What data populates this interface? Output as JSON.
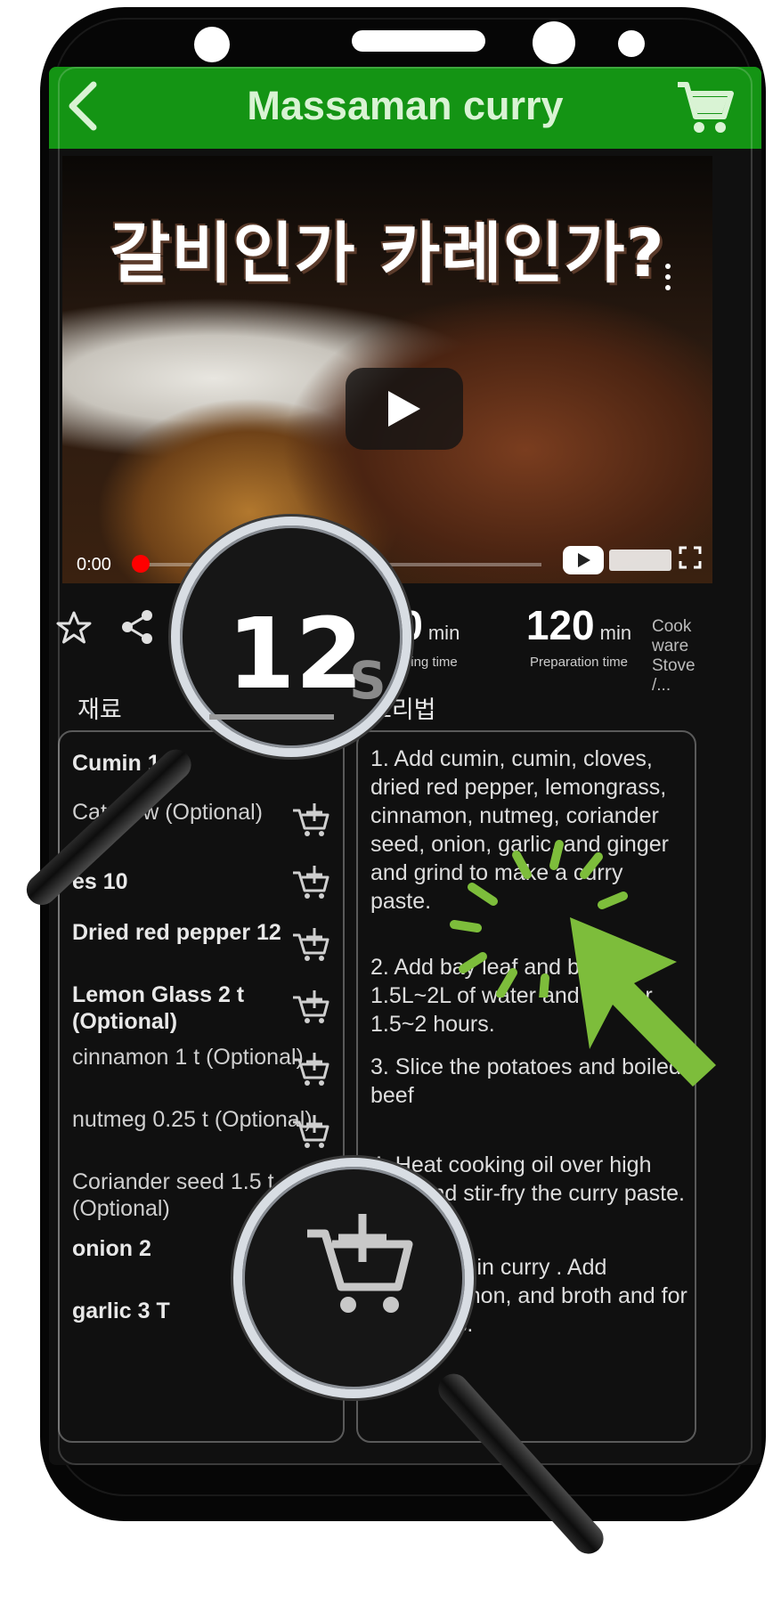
{
  "app": {
    "title": "Massaman curry"
  },
  "video": {
    "caption": "갈비인가 카레인가?",
    "current_time": "0:00",
    "progress": 0.0
  },
  "stats": {
    "cooking": {
      "value": "30",
      "unit": "min",
      "label": "Cooking time"
    },
    "preparation": {
      "value": "120",
      "unit": "min",
      "label": "Preparation time"
    },
    "cookware": "Cook ware Stove /..."
  },
  "sections": {
    "ingredients_title": "재료",
    "recipe_title": "조리법"
  },
  "ingredients": [
    {
      "name": "Cumin  1.5",
      "bold": true
    },
    {
      "name": "Catchew (Optional)",
      "bold": false
    },
    {
      "name": "es  10",
      "bold": true
    },
    {
      "name": "Dried red pepper 12",
      "bold": true
    },
    {
      "name": "Lemon Glass  2 t (Optional)",
      "bold": true
    },
    {
      "name": "cinnamon  1 t (Optional)",
      "bold": false
    },
    {
      "name": "nutmeg  0.25 t (Optional)",
      "bold": false
    },
    {
      "name": "Coriander seed  1.5 t (Optional)",
      "bold": false
    },
    {
      "name": "onion  2",
      "bold": true
    },
    {
      "name": "garlic  3 T",
      "bold": true
    }
  ],
  "recipe_steps": [
    "1. Add cumin, cumin, cloves, dried red pepper, lemongrass, cinnamon, nutmeg, coriander seed, onion, garlic, and ginger and grind to make a curry paste.",
    "2. Add bay leaf and beef to 1.5L~2L of water and boil for 1.5~2 hours.",
    "3. Slice the potatoes and boiled beef",
    "4. Heat cooking oil over high heat and stir-fry the curry paste.",
    "conut milk in curry . Add octagon, mon, and broth and for 3 minutes."
  ],
  "overlay": {
    "magnified_value": "12",
    "magnified_suffix": "S"
  },
  "colors": {
    "appbar": "#149414",
    "accent_green": "#7dbd3b",
    "progress": "#ff0000"
  }
}
